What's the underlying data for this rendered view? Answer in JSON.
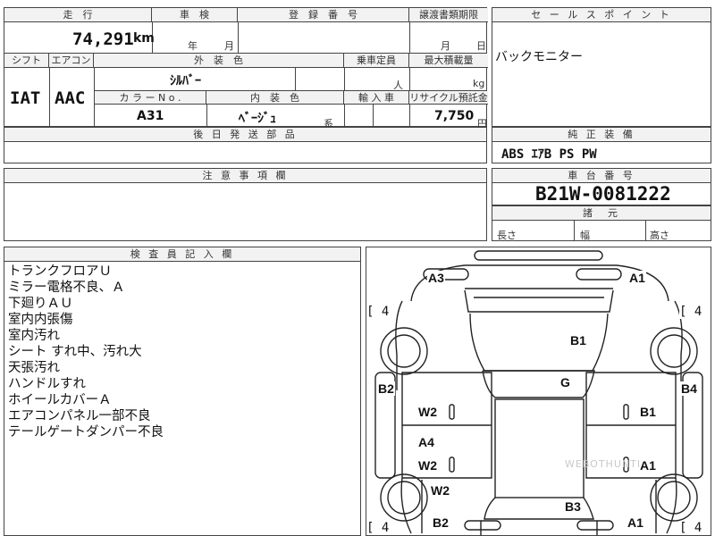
{
  "headers": {
    "mileage": "走　行",
    "inspection": "車　検",
    "registration": "登　録　番　号",
    "transfer_deadline": "譲渡書類期限",
    "sales_point": "セ ー ル ス ポ イ ン ト",
    "shift": "シフト",
    "ac": "エアコン",
    "exterior_color": "外　装　色",
    "capacity": "乗車定員",
    "max_load": "最大積載量",
    "color_no": "カ ラ ー  N o .",
    "interior_color": "内　装　色",
    "import": "輸 入 車",
    "recycle": "リサイクル預託金",
    "later_parts": "後 日 発 送 部 品",
    "standard_equipment": "純 正 装 備",
    "caution": "注 意 事 項 欄",
    "chassis_no": "車 台 番 号",
    "dimensions": "諸　元",
    "inspector_notes": "検 査 員 記 入 欄"
  },
  "vehicle": {
    "mileage": "74,291",
    "mileage_unit": "km",
    "inspection_year_unit": "年",
    "inspection_month_unit": "月",
    "transfer_month_unit": "月",
    "transfer_day_unit": "日",
    "shift": "IAT",
    "ac": "AAC",
    "exterior_color": "ｼﾙﾊﾞｰ",
    "capacity_unit": "人",
    "load_unit": "kg",
    "color_no": "A31",
    "interior_color": "ﾍﾞｰｼﾞｭ",
    "interior_suffix": "系",
    "recycle_amount": "7,750",
    "recycle_unit": "円",
    "sales_point": "バックモニター",
    "standard_equipment": "ABS  ｴｱB  PS  PW",
    "chassis_no": "B21W-0081222",
    "dim_length": "長さ",
    "dim_width": "幅",
    "dim_height": "高さ"
  },
  "notes": [
    "トランクフロアＵ",
    "ミラー電格不良、Ａ",
    "下廻りＡＵ",
    "室内内張傷",
    "室内汚れ",
    "シート すれ中、汚れ大",
    "天張汚れ",
    "ハンドルすれ",
    "ホイールカバーＡ",
    "エアコンパネル一部不良",
    "テールゲートダンパー不良"
  ],
  "diagram": {
    "tire_front_left": "[ 4",
    "tire_front_right": "[ 4",
    "tire_rear_left": "[ 4",
    "tire_rear_right": "[ 4",
    "marks": {
      "a3": "A3",
      "a1_top": "A1",
      "b1_hood": "B1",
      "g_roof": "G",
      "b2_left": "B2",
      "b4_right": "B4",
      "w2_front_door": "W2",
      "b1_front_door": "B1",
      "a4_rear_door": "A4",
      "w2_rear_door": "W2",
      "a1_rear_door": "A1",
      "w2_rear_fender": "W2",
      "b3_trunk": "B3",
      "b2_bottom": "B2",
      "a1_bottom": "A1"
    },
    "watermark": "WEBOTHUNTER"
  }
}
